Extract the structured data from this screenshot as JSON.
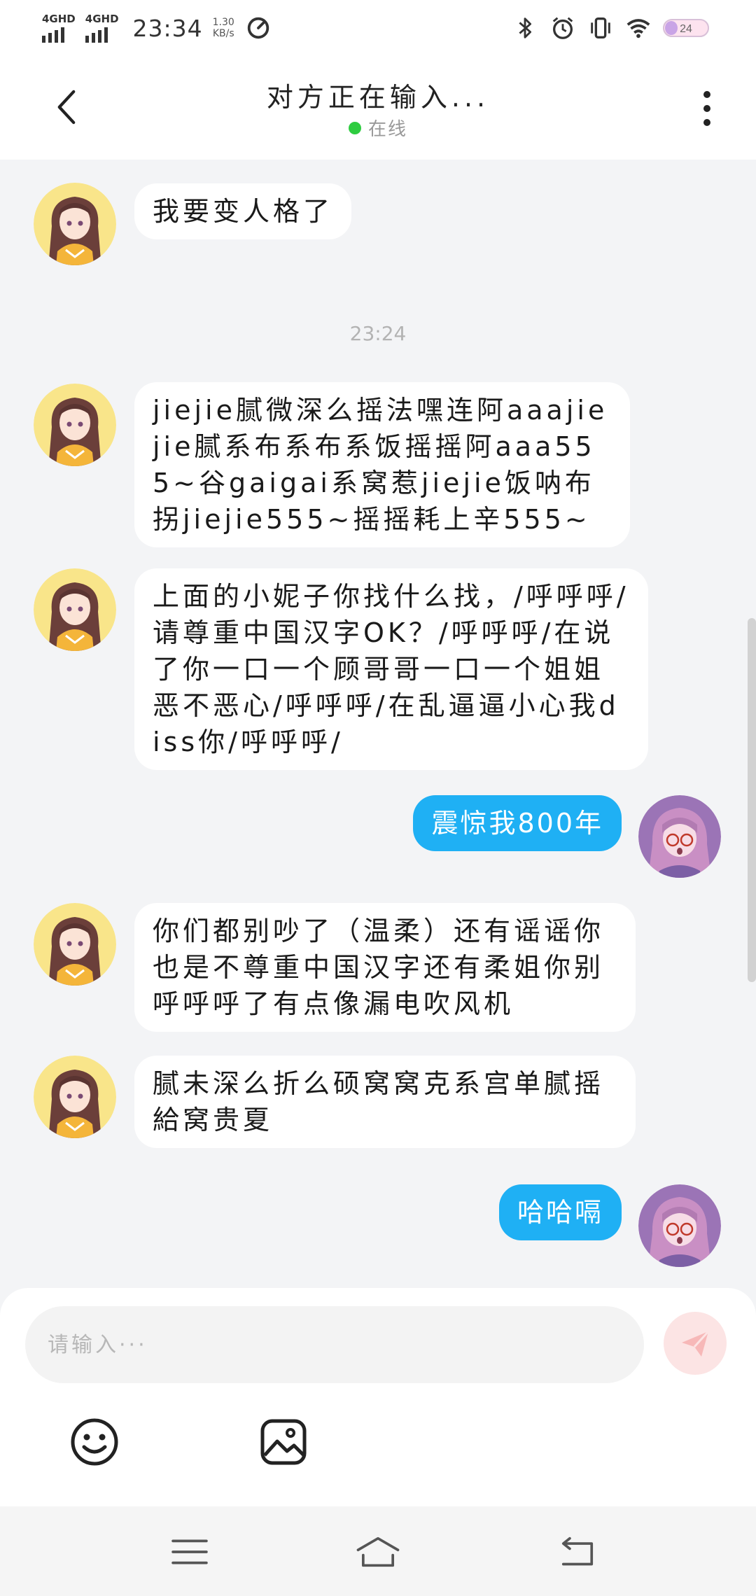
{
  "status_bar": {
    "network1": "4GHD",
    "network2": "4GHD",
    "time": "23:34",
    "speed_value": "1.30",
    "speed_unit": "KB/s",
    "battery_level": "24",
    "icons": [
      "bluetooth-icon",
      "alarm-icon",
      "vibrate-icon",
      "wifi-icon",
      "battery-icon"
    ]
  },
  "header": {
    "title": "对方正在输入...",
    "status": "在线"
  },
  "chat": {
    "timestamp": "23:24",
    "messages": [
      {
        "sender": "other",
        "text": "我要变人格了"
      },
      {
        "sender": "other",
        "text": "jiejie腻微深么摇法嘿连阿aaajiejie腻系布系布系饭摇摇阿aaa555~谷gaigai系窝惹jiejie饭呐布拐jiejie555~摇摇耗上辛555~"
      },
      {
        "sender": "other",
        "text": "上面的小妮子你找什么找，/呼呼呼/请尊重中国汉字OK？/呼呼呼/在说了你一口一个顾哥哥一口一个姐姐恶不恶心/呼呼呼/在乱逼逼小心我diss你/呼呼呼/"
      },
      {
        "sender": "me",
        "text": "震惊我800年"
      },
      {
        "sender": "other",
        "text": "你们都别吵了（温柔）还有谣谣你也是不尊重中国汉字还有柔姐你别呼呼呼了有点像漏电吹风机"
      },
      {
        "sender": "other",
        "text": "腻未深么折么硕窝窝克系宫单腻摇給窝贵夏"
      },
      {
        "sender": "me",
        "text": "哈哈嗝"
      }
    ]
  },
  "input": {
    "placeholder": "请输入···",
    "value": ""
  },
  "colors": {
    "my_bubble": "#1fb0f4",
    "other_bubble": "#ffffff",
    "background": "#f3f4f6",
    "online": "#2ecc40",
    "send_button": "#fce4e4"
  }
}
